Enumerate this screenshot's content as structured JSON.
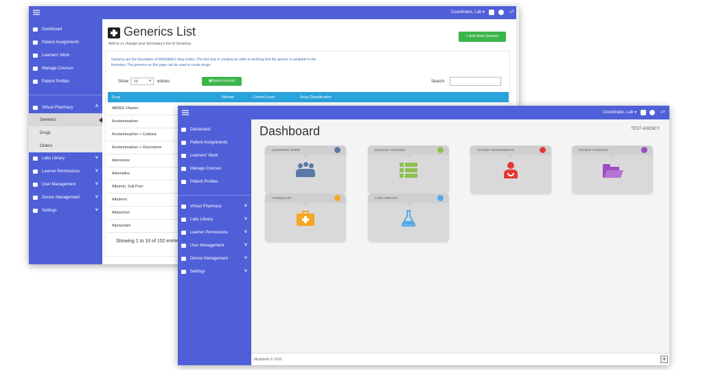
{
  "back_window": {
    "topbar": {
      "user_label": "Coordinator, Lab ▾"
    },
    "sidebar": {
      "items": [
        {
          "label": "Dashboard",
          "icon": "dashboard-icon"
        },
        {
          "label": "Patient Assignments",
          "icon": "bed-icon"
        },
        {
          "label": "Learners' Work",
          "icon": "users-icon"
        },
        {
          "label": "Manage Courses",
          "icon": "list-icon"
        },
        {
          "label": "Patient Profiles",
          "icon": "folder-icon"
        }
      ],
      "group": [
        {
          "label": "Virtual Pharmacy",
          "icon": "pharmacy-icon"
        }
      ],
      "subitems": [
        {
          "label": "Generics"
        },
        {
          "label": "Drugs"
        },
        {
          "label": "Orders"
        }
      ],
      "more": [
        {
          "label": "Labs Library",
          "icon": "flask-icon"
        },
        {
          "label": "Learner Permissions",
          "icon": "lock-icon"
        },
        {
          "label": "User Management",
          "icon": "user-icon"
        },
        {
          "label": "Device Management",
          "icon": "monitor-icon"
        },
        {
          "label": "Settings",
          "icon": "gear-icon"
        }
      ]
    },
    "main": {
      "title": "Generics List",
      "subtitle": "Add to or change your formulary's list of Generics",
      "add_button": "+ Add New Generic",
      "info": "Generics are the foundation of MediSkills's drug orders. The first step in creating an order is verifying that the generic is available in the formulary. The generics on this page can be used to create drugs.",
      "show_label": "Show",
      "entries_value": "10",
      "entries_label": "entries",
      "export_button": "Export to Excel",
      "search_label": "Search:",
      "columns": [
        "Drug",
        "Tallman",
        "Control Level",
        "Drug Classification"
      ],
      "rows": [
        "ABDEK Vitamin",
        "Acetaminophen",
        "Acetaminophen + Codeine",
        "Acetaminophen + Oxycodone",
        "Adenosine",
        "Adrenaline",
        "Albumin, Salt Pure",
        "Albuterol",
        "Allopurinol",
        "Alprazolam"
      ],
      "showing": "Showing 1 to 10 of 152 entries"
    }
  },
  "front_window": {
    "topbar": {
      "user_label": "Coordinator, Lab ▾"
    },
    "sidebar": {
      "items": [
        {
          "label": "Dashboard",
          "icon": "dashboard-icon"
        },
        {
          "label": "Patient Assignments",
          "icon": "bed-icon"
        },
        {
          "label": "Learners' Work",
          "icon": "users-icon"
        },
        {
          "label": "Manage Courses",
          "icon": "list-icon"
        },
        {
          "label": "Patient Profiles",
          "icon": "folder-icon"
        }
      ],
      "groups": [
        {
          "label": "Virtual Pharmacy",
          "icon": "pharmacy-icon"
        },
        {
          "label": "Labs Library",
          "icon": "flask-icon"
        },
        {
          "label": "Learner Permissions",
          "icon": "lock-icon"
        },
        {
          "label": "User Management",
          "icon": "user-icon"
        },
        {
          "label": "Device Management",
          "icon": "monitor-icon"
        },
        {
          "label": "Settings",
          "icon": "gear-icon"
        }
      ]
    },
    "main": {
      "title": "Dashboard",
      "agency": "TEST AGENCY",
      "cards": [
        {
          "label": "LEARNERS' WORK",
          "dot": "#5b79a8",
          "icon": "users-icon",
          "color": "#5b79a8"
        },
        {
          "label": "MANAGE COURSES",
          "dot": "#8cc152",
          "icon": "list-icon",
          "color": "#8cc152"
        },
        {
          "label": "PATIENT ASSIGNMENTS",
          "dot": "#e53935",
          "icon": "doctor-icon",
          "color": "#e53935"
        },
        {
          "label": "PATIENT PROFILES",
          "dot": "#9c4dc4",
          "icon": "folder-open-icon",
          "color": "#9c4dc4"
        },
        {
          "label": "FORMULARY",
          "dot": "#f5a623",
          "icon": "medkit-icon",
          "color": "#f5a623"
        },
        {
          "label": "LABS LIBRARY",
          "dot": "#4fa8e8",
          "icon": "flask-icon",
          "color": "#4fa8e8"
        }
      ],
      "footer": "MediSkills © 2018"
    }
  }
}
